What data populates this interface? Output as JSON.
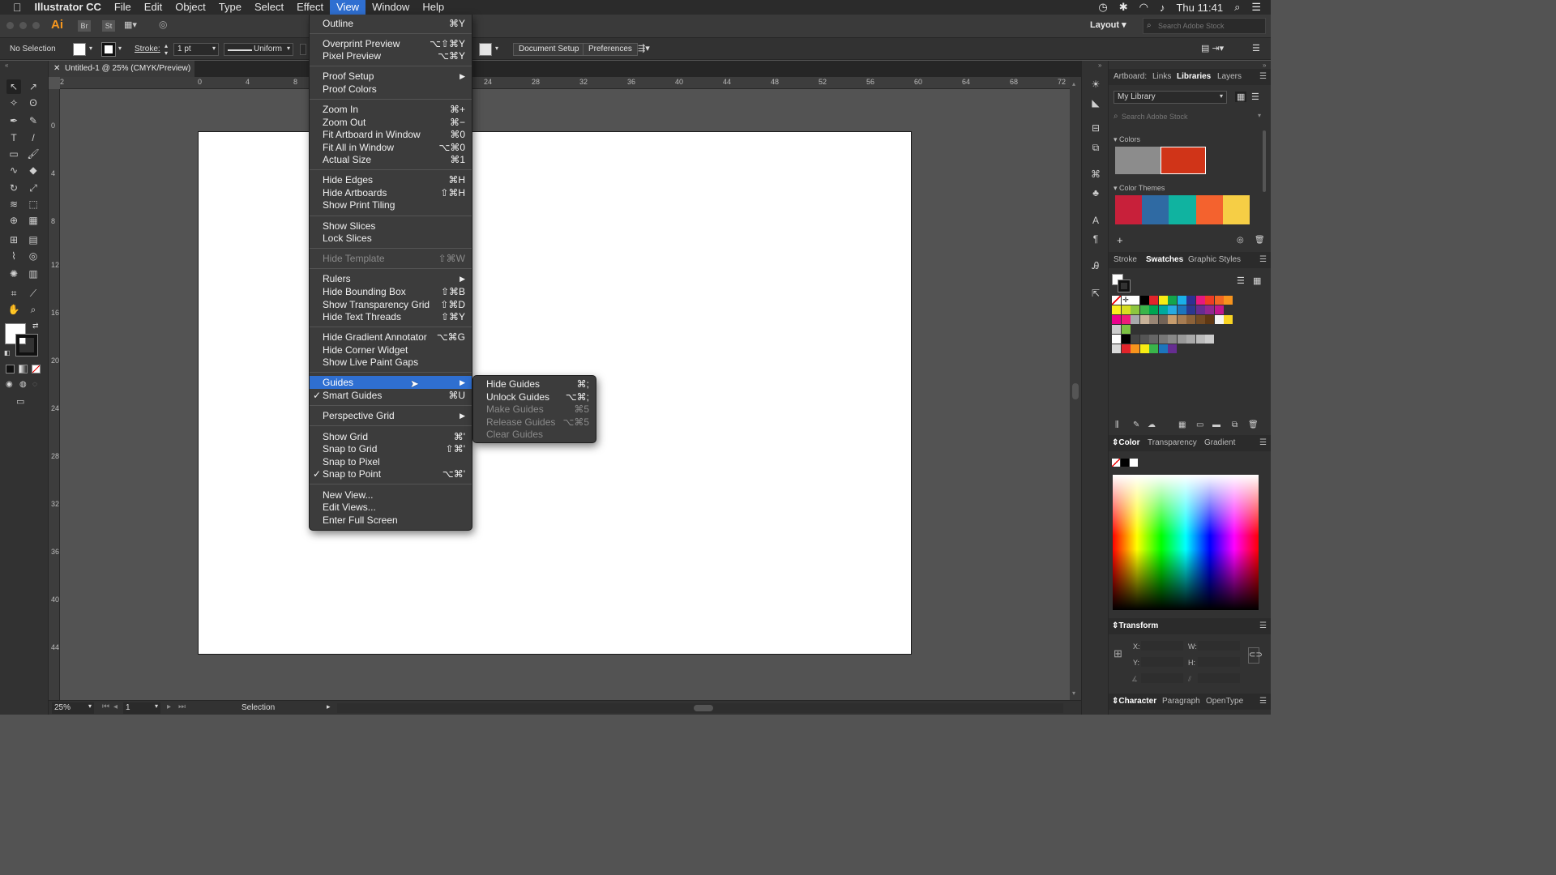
{
  "menubar": {
    "app": "Illustrator CC",
    "items": [
      "File",
      "Edit",
      "Object",
      "Type",
      "Select",
      "Effect",
      "View",
      "Window",
      "Help"
    ],
    "clock": "Thu 11:41"
  },
  "topbar": {
    "layout_label": "Layout",
    "search_placeholder": "Search Adobe Stock",
    "br": "Br",
    "st": "St"
  },
  "control": {
    "selection": "No Selection",
    "stroke_label": "Stroke:",
    "stroke_value": "1 pt",
    "profile": "Uniform",
    "doc_setup": "Document Setup",
    "prefs": "Preferences"
  },
  "document": {
    "tab_title": "Untitled-1 @ 25% (CMYK/Preview)",
    "hticks": [
      "2",
      "0",
      "4",
      "8",
      "12",
      "16",
      "20",
      "24",
      "28",
      "32",
      "36",
      "40",
      "44",
      "48",
      "52",
      "56",
      "60",
      "64",
      "68",
      "72"
    ],
    "vticks": [
      "0",
      "4",
      "8",
      "12",
      "16",
      "20",
      "24",
      "28",
      "32",
      "36",
      "40",
      "44"
    ]
  },
  "status": {
    "zoom": "25%",
    "page": "1",
    "tool": "Selection"
  },
  "panels": {
    "libraries": {
      "tabs": [
        "Artboard:",
        "Links",
        "Libraries",
        "Layers"
      ],
      "selected": "Libraries",
      "library": "My Library",
      "search_placeholder": "Search Adobe Stock",
      "colors_heading": "Colors",
      "themes_heading": "Color Themes"
    },
    "swatches": {
      "tabs": [
        "Stroke",
        "Swatches",
        "Graphic Styles"
      ],
      "selected": "Swatches"
    },
    "color": {
      "tabs": [
        "Color",
        "Transparency",
        "Gradient"
      ],
      "selected": "Color"
    },
    "transform": {
      "title": "Transform",
      "x": "X:",
      "y": "Y:",
      "w": "W:",
      "h": "H:"
    },
    "character": {
      "tabs": [
        "Character",
        "Paragraph",
        "OpenType"
      ],
      "selected": "Character"
    }
  },
  "view_menu": {
    "outline": {
      "label": "Outline",
      "shortcut": "⌘Y"
    },
    "overprint": {
      "label": "Overprint Preview",
      "shortcut": "⌥⇧⌘Y"
    },
    "pixel": {
      "label": "Pixel Preview",
      "shortcut": "⌥⌘Y"
    },
    "proof_setup": {
      "label": "Proof Setup"
    },
    "proof_colors": {
      "label": "Proof Colors"
    },
    "zoom_in": {
      "label": "Zoom In",
      "shortcut": "⌘+"
    },
    "zoom_out": {
      "label": "Zoom Out",
      "shortcut": "⌘−"
    },
    "fit_artboard": {
      "label": "Fit Artboard in Window",
      "shortcut": "⌘0"
    },
    "fit_all": {
      "label": "Fit All in Window",
      "shortcut": "⌥⌘0"
    },
    "actual": {
      "label": "Actual Size",
      "shortcut": "⌘1"
    },
    "hide_edges": {
      "label": "Hide Edges",
      "shortcut": "⌘H"
    },
    "hide_artboards": {
      "label": "Hide Artboards",
      "shortcut": "⇧⌘H"
    },
    "print_tiling": {
      "label": "Show Print Tiling"
    },
    "show_slices": {
      "label": "Show Slices"
    },
    "lock_slices": {
      "label": "Lock Slices"
    },
    "hide_template": {
      "label": "Hide Template",
      "shortcut": "⇧⌘W"
    },
    "rulers": {
      "label": "Rulers"
    },
    "bounding": {
      "label": "Hide Bounding Box",
      "shortcut": "⇧⌘B"
    },
    "transparency_grid": {
      "label": "Show Transparency Grid",
      "shortcut": "⇧⌘D"
    },
    "text_threads": {
      "label": "Hide Text Threads",
      "shortcut": "⇧⌘Y"
    },
    "gradient_annotator": {
      "label": "Hide Gradient Annotator",
      "shortcut": "⌥⌘G"
    },
    "corner_widget": {
      "label": "Hide Corner Widget"
    },
    "live_paint": {
      "label": "Show Live Paint Gaps"
    },
    "guides": {
      "label": "Guides"
    },
    "smart_guides": {
      "label": "Smart Guides",
      "shortcut": "⌘U"
    },
    "perspective": {
      "label": "Perspective Grid"
    },
    "show_grid": {
      "label": "Show Grid",
      "shortcut": "⌘'"
    },
    "snap_grid": {
      "label": "Snap to Grid",
      "shortcut": "⇧⌘'"
    },
    "snap_pixel": {
      "label": "Snap to Pixel"
    },
    "snap_point": {
      "label": "Snap to Point",
      "shortcut": "⌥⌘'"
    },
    "new_view": {
      "label": "New View..."
    },
    "edit_views": {
      "label": "Edit Views..."
    },
    "full_screen": {
      "label": "Enter Full Screen"
    }
  },
  "guides_submenu": {
    "hide": {
      "label": "Hide Guides",
      "shortcut": "⌘;"
    },
    "unlock": {
      "label": "Unlock Guides",
      "shortcut": "⌥⌘;"
    },
    "make": {
      "label": "Make Guides",
      "shortcut": "⌘5"
    },
    "release": {
      "label": "Release Guides",
      "shortcut": "⌥⌘5"
    },
    "clear": {
      "label": "Clear Guides"
    }
  },
  "colors": {
    "accent": "#2f6fd1",
    "library_swatches": [
      "#8c8c8c",
      "#d03418"
    ],
    "theme": [
      "#c8203a",
      "#2f6aa3",
      "#10b3a0",
      "#f4622e",
      "#f6ce45"
    ]
  }
}
